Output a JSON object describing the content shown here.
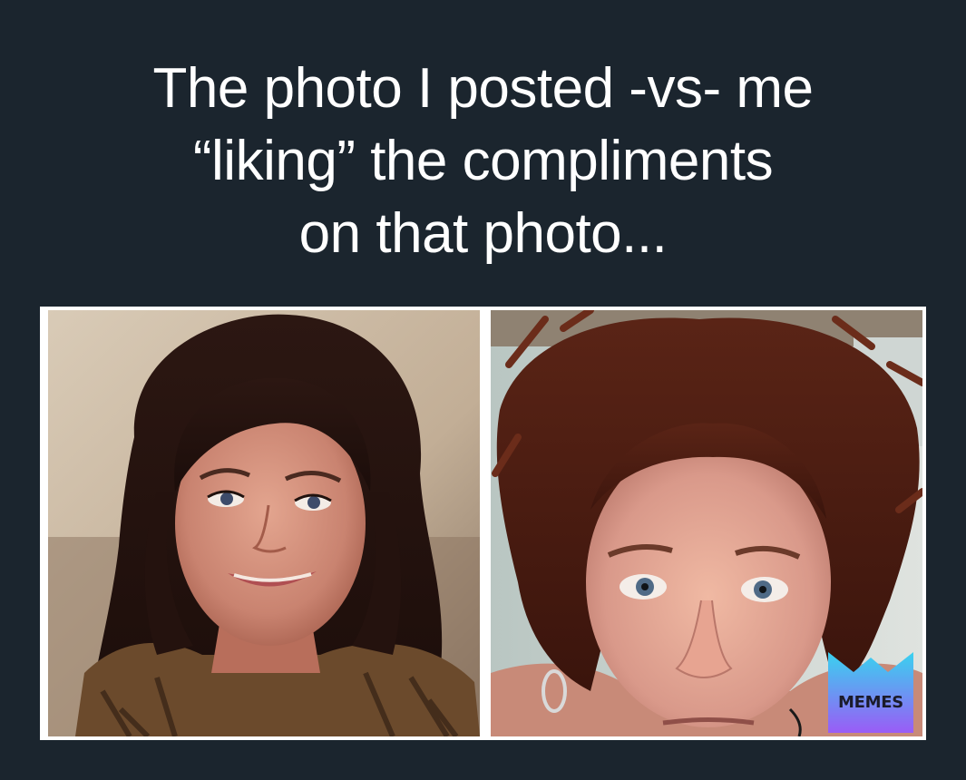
{
  "caption": {
    "lines": [
      "The photo I posted -vs- me",
      "“liking” the compliments",
      "on that photo..."
    ]
  },
  "photos": [
    {
      "icon": "woman-smiling-selfie-image"
    },
    {
      "icon": "woman-messy-hair-selfie-image"
    }
  ],
  "watermark": {
    "label": "MEMES",
    "colors": {
      "top": "#39d2ef",
      "bottom": "#9a5cf6"
    }
  }
}
